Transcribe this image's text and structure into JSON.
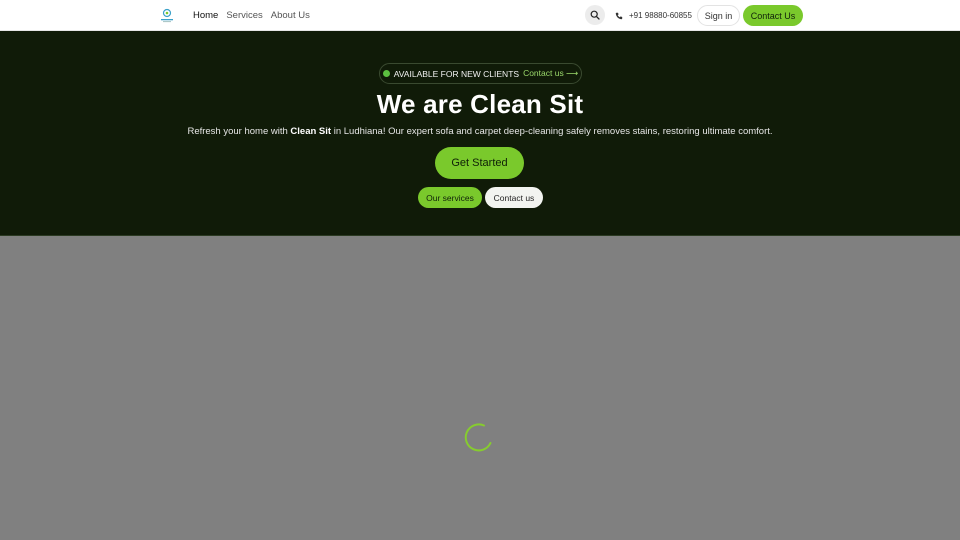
{
  "header": {
    "nav": [
      "Home",
      "Services",
      "About Us"
    ],
    "phone": "+91 98880-60855",
    "signin_label": "Sign in",
    "contact_label": "Contact Us",
    "icons": {
      "search": "search-icon",
      "phone": "phone-icon",
      "logo": "logo-icon"
    }
  },
  "hero": {
    "badge_text": "AVAILABLE FOR NEW CLIENTS",
    "badge_link": "Contact us ⟶",
    "title": "We are Clean Sit",
    "subtitle_pre": "Refresh your home with ",
    "subtitle_brand": "Clean Sit",
    "subtitle_post": " in Ludhiana! Our expert sofa and carpet deep-cleaning safely removes stains, restoring ultimate comfort.",
    "cta_label": "Get Started",
    "services_label": "Our services",
    "contact_label": "Contact us"
  },
  "colors": {
    "accent": "#7ac92c",
    "hero_bg": "#101b08",
    "loader_bg": "#808080",
    "status_dot": "#5cc040"
  }
}
